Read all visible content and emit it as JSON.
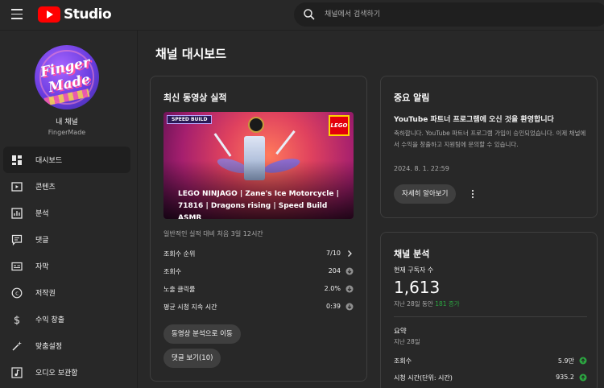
{
  "header": {
    "logo_text": "Studio",
    "search_placeholder": "채널에서 검색하기"
  },
  "sidebar": {
    "avatar_text_1": "Finger",
    "avatar_text_2": "Made",
    "channel_label": "내 채널",
    "channel_name": "FingerMade",
    "items": [
      {
        "label": "대시보드",
        "icon": "dashboard-icon",
        "active": true
      },
      {
        "label": "콘텐츠",
        "icon": "content-icon"
      },
      {
        "label": "분석",
        "icon": "analytics-icon"
      },
      {
        "label": "댓글",
        "icon": "comments-icon"
      },
      {
        "label": "자막",
        "icon": "subtitles-icon"
      },
      {
        "label": "저작권",
        "icon": "copyright-icon"
      },
      {
        "label": "수익 창출",
        "icon": "dollar-icon"
      },
      {
        "label": "맞춤설정",
        "icon": "magic-wand-icon"
      },
      {
        "label": "오디오 보관함",
        "icon": "audio-library-icon"
      }
    ]
  },
  "main": {
    "title": "채널 대시보드",
    "latest_video": {
      "card_title": "최신 동영상 실적",
      "badge": "SPEED BUILD",
      "brand": "LEGO",
      "video_title": "LEGO NINJAGO | Zane's Ice Motorcycle | 71816 | Dragons rising | Speed Build ASMR",
      "performance_note": "일반적인 실적 대비 처음 3일 12시간",
      "stats": [
        {
          "name": "조회수 순위",
          "value": "7/10",
          "indicator": "chevron-right-icon"
        },
        {
          "name": "조회수",
          "value": "204",
          "indicator": "down-arrow-icon"
        },
        {
          "name": "노출 클릭률",
          "value": "2.0%",
          "indicator": "down-arrow-icon"
        },
        {
          "name": "평균 시청 지속 시간",
          "value": "0:39",
          "indicator": "down-arrow-icon"
        }
      ],
      "button_analytics": "동영상 분석으로 이동",
      "button_comments": "댓글 보기(10)"
    },
    "notice": {
      "card_title": "중요 알림",
      "headline": "YouTube 파트너 프로그램에 오신 것을 환영합니다",
      "body": "축하합니다. YouTube 파트너 프로그램 가입이 승인되었습니다. 이제 채널에서 수익을 창출하고 지원팀에 문의할 수 있습니다.",
      "date": "2024. 8. 1. 22:59",
      "learn_more": "자세히 알아보기"
    },
    "analytics": {
      "card_title": "채널 분석",
      "subscribers_label": "현재 구독자 수",
      "subscribers_value": "1,613",
      "change_prefix": "지난 28일 동안",
      "change_value": "181 증가",
      "summary_label": "요약",
      "summary_period": "지난 28일",
      "rows": [
        {
          "name": "조회수",
          "value": "5.9만"
        },
        {
          "name": "시청 시간(단위: 시간)",
          "value": "935.2"
        }
      ],
      "up_color": "#2ba640"
    }
  }
}
